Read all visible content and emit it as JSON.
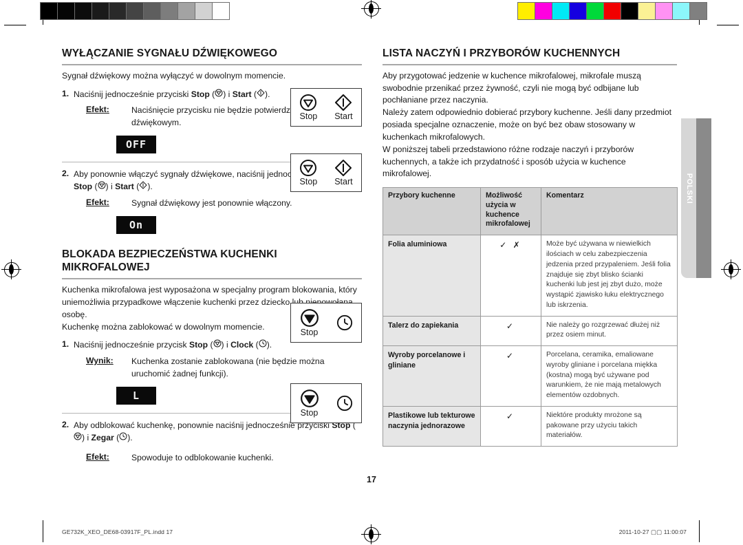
{
  "document": {
    "page_number": "17",
    "language_tab": "POLSKI",
    "footer": {
      "filename": "GE732K_XEO_DE68-03917F_PL.indd   17",
      "timestamp": "2011-10-27   ▢▢ 11:00:07"
    }
  },
  "calibration": {
    "grayscale_label": "grayscale-step-wedge",
    "grayscale_swatches": [
      "#000000",
      "#050505",
      "#0c0c0c",
      "#1a1a1a",
      "#292929",
      "#444444",
      "#5e5e5e",
      "#7d7d7d",
      "#a3a3a3",
      "#d2d2d2",
      "#ffffff"
    ],
    "color_label": "process-color-bar",
    "color_swatches": [
      "#ffee00",
      "#ff00e0",
      "#00e9f6",
      "#1500e0",
      "#00d93a",
      "#f10000",
      "#000000",
      "#fbf195",
      "#ff92f3",
      "#8cf6fb",
      "#808080"
    ]
  },
  "left_column": {
    "section_sound": {
      "title": "Wyłączanie sygnału dźwiękowego",
      "intro": "Sygnał dźwiękowy można wyłączyć w dowolnym momencie.",
      "step1": {
        "number": "1.",
        "text_a": "Naciśnij jednocześnie przyciski ",
        "bold_stop": "Stop",
        "text_b": " (",
        "text_c": ") i ",
        "bold_start": "Start",
        "text_d": " (",
        "text_e": ").",
        "result_label": "Efekt:",
        "result_text": "Naciśnięcie przycisku nie będzie potwierdzane sygnałem dźwiękowym.",
        "led_display": "OFF",
        "keybox": {
          "key1_icon": "stop-icon",
          "key1_label": "Stop",
          "key2_icon": "start-icon",
          "key2_label": "Start"
        }
      },
      "step2": {
        "number": "2.",
        "text_a": "Aby ponownie włączyć sygnały dźwiękowe, naciśnij jednocześnie przyciski ",
        "bold_stop": "Stop",
        "text_b": " (",
        "text_c": ") i ",
        "bold_start": "Start",
        "text_d": " (",
        "text_e": ").",
        "result_label": "Efekt:",
        "result_text": "Sygnał dźwiękowy jest ponownie włączony.",
        "led_display": "On",
        "keybox": {
          "key1_icon": "stop-icon",
          "key1_label": "Stop",
          "key2_icon": "start-icon",
          "key2_label": "Start"
        }
      }
    },
    "section_lock": {
      "title": "Blokada bezpieczeństwa kuchenki mikrofalowej",
      "intro_1": "Kuchenka mikrofalowa jest wyposażona w specjalny program blokowania, który uniemożliwia przypadkowe włączenie kuchenki przez dziecko lub niepowołaną osobę.",
      "intro_2": "Kuchenkę można zablokować w dowolnym momencie.",
      "step1": {
        "number": "1.",
        "text_a": "Naciśnij jednocześnie przycisk ",
        "bold_stop": "Stop",
        "text_b": " (",
        "text_c": ") i ",
        "bold_clock": "Clock",
        "text_d": " (",
        "text_e": ").",
        "result_label": "Wynik:",
        "result_text": "Kuchenka zostanie zablokowana (nie będzie można uruchomić żadnej funkcji).",
        "led_display": "L",
        "keybox": {
          "key1_icon": "stop-icon",
          "key1_label": "Stop",
          "key2_icon": "clock-icon",
          "key2_label": ""
        }
      },
      "step2": {
        "number": "2.",
        "text_a": "Aby odblokować kuchenkę, ponownie naciśnij jednocześnie przyciski ",
        "bold_stop": "Stop",
        "text_b": " (",
        "text_c": ") i ",
        "bold_clock": "Zegar",
        "text_d": " (",
        "text_e": ").",
        "result_label": "Efekt:",
        "result_text": "Spowoduje to odblokowanie kuchenki.",
        "keybox": {
          "key1_icon": "stop-icon",
          "key1_label": "Stop",
          "key2_icon": "clock-icon",
          "key2_label": ""
        }
      }
    }
  },
  "right_column": {
    "title": "Lista naczyń i przyborów kuchennych",
    "paragraphs": [
      "Aby przygotować jedzenie w kuchence mikrofalowej, mikrofale muszą swobodnie przenikać przez żywność, czyli nie mogą być odbijane lub pochłaniane przez naczynia.",
      "Należy zatem odpowiednio dobierać przybory kuchenne. Jeśli dany przedmiot posiada specjalne oznaczenie, może on być bez obaw stosowany w kuchenkach mikrofalowych.",
      "W poniższej tabeli przedstawiono różne rodzaje naczyń i przyborów kuchennych, a także ich przydatność i sposób użycia w kuchence mikrofalowej."
    ],
    "table": {
      "headers": [
        "Przybory kuchenne",
        "Możliwość użycia w kuchence mikrofalowej",
        "Komentarz"
      ],
      "rows": [
        {
          "item": "Folia aluminiowa",
          "usable": "✓ ✗",
          "comment": "Może być używana w niewielkich ilościach w celu zabezpieczenia jedzenia przed przypaleniem. Jeśli folia znajduje się zbyt blisko ścianki kuchenki lub jest jej zbyt dużo, może wystąpić zjawisko łuku elektrycznego lub iskrzenia."
        },
        {
          "item": "Talerz do zapiekania",
          "usable": "✓",
          "comment": "Nie należy go rozgrzewać dłużej niż przez osiem minut."
        },
        {
          "item": "Wyroby porcelanowe i gliniane",
          "usable": "✓",
          "comment": "Porcelana, ceramika, emaliowane wyroby gliniane i porcelana miękka (kostna) mogą być używane pod warunkiem, że nie mają metalowych elementów ozdobnych."
        },
        {
          "item": "Plastikowe lub tekturowe naczynia jednorazowe",
          "usable": "✓",
          "comment": "Niektóre produkty mrożone są pakowane przy użyciu takich materiałów."
        }
      ]
    }
  }
}
